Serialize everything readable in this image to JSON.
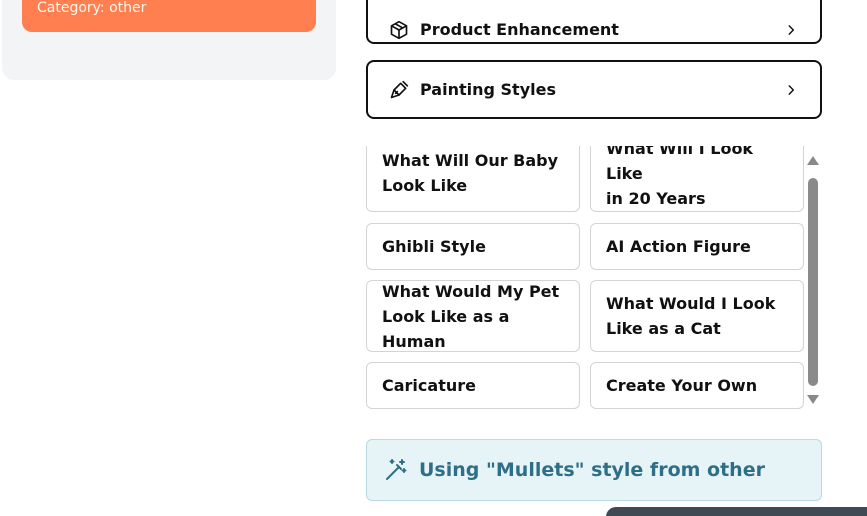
{
  "left_panel": {
    "category_label": "Category: other"
  },
  "accordions": [
    {
      "label": "Product Enhancement",
      "icon": "cube-icon"
    },
    {
      "label": "Painting Styles",
      "icon": "paintbrush-icon"
    }
  ],
  "options": [
    {
      "label_lines": [
        "What Will Our Baby",
        "Look Like"
      ]
    },
    {
      "label_lines": [
        "What Will I Look Like",
        "in 20 Years"
      ]
    },
    {
      "label_lines": [
        "Ghibli Style"
      ]
    },
    {
      "label_lines": [
        "AI Action Figure"
      ]
    },
    {
      "label_lines": [
        "What Would My Pet",
        "Look Like as a Human"
      ]
    },
    {
      "label_lines": [
        "What Would I Look",
        "Like as a Cat"
      ]
    },
    {
      "label_lines": [
        "Caricature"
      ]
    },
    {
      "label_lines": [
        "Create Your Own"
      ]
    }
  ],
  "status": {
    "text": "Using \"Mullets\" style from other",
    "icon": "magic-wand-icon"
  },
  "colors": {
    "category_card": "#ff7f50",
    "status_background": "#e6f3f7",
    "status_text": "#2e6f87"
  }
}
